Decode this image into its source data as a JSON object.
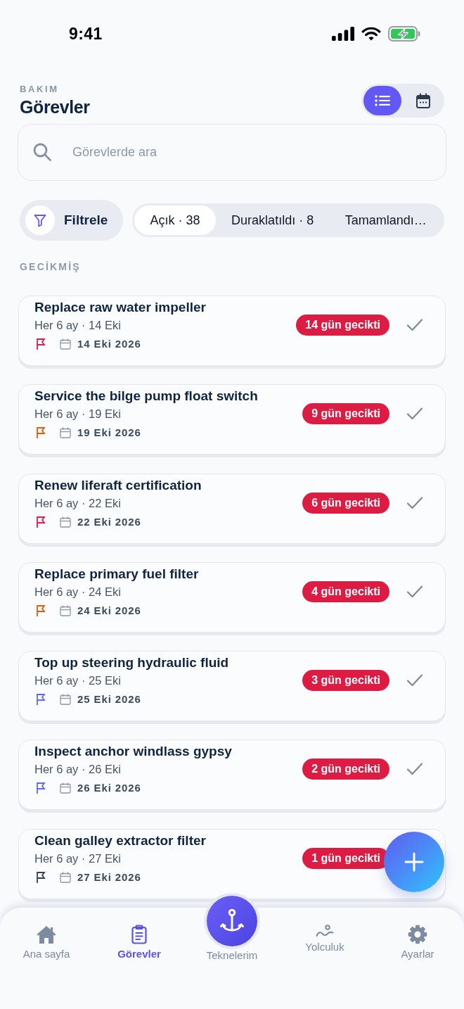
{
  "status_bar": {
    "time": "9:41"
  },
  "header": {
    "eyebrow": "BAKIM",
    "title": "Görevler",
    "views": [
      {
        "kind": "list",
        "selected": true
      },
      {
        "kind": "calendar",
        "selected": false
      }
    ]
  },
  "search": {
    "placeholder": "Görevlerde ara"
  },
  "filter_button": {
    "label": "Filtrele"
  },
  "status_tabs": [
    {
      "label": "Açık · 38",
      "selected": true
    },
    {
      "label": "Duraklatıldı · 8",
      "selected": false
    },
    {
      "label": "Tamamlandı…",
      "selected": false
    }
  ],
  "sections": [
    {
      "title": "GECİKMİŞ",
      "tasks": [
        {
          "title": "Replace raw water impeller",
          "recurrence": "Her 6 ay · 14 Eki",
          "due_date": "14 Eki 2026",
          "color": "#e11d48",
          "badge": "14 gün gecikti"
        },
        {
          "title": "Service the bilge pump float switch",
          "recurrence": "Her 6 ay · 19 Eki",
          "due_date": "19 Eki 2026",
          "color": "#ea580c",
          "badge": "9 gün gecikti"
        },
        {
          "title": "Renew liferaft certification",
          "recurrence": "Her 6 ay · 22 Eki",
          "due_date": "22 Eki 2026",
          "color": "#e11d48",
          "badge": "6 gün gecikti"
        },
        {
          "title": "Replace primary fuel filter",
          "recurrence": "Her 6 ay · 24 Eki",
          "due_date": "24 Eki 2026",
          "color": "#ea580c",
          "badge": "4 gün gecikti"
        },
        {
          "title": "Top up steering hydraulic fluid",
          "recurrence": "Her 6 ay · 25 Eki",
          "due_date": "25 Eki 2026",
          "color": "#6366f1",
          "badge": "3 gün gecikti"
        },
        {
          "title": "Inspect anchor windlass gypsy",
          "recurrence": "Her 6 ay · 26 Eki",
          "due_date": "26 Eki 2026",
          "color": "#6366f1",
          "badge": "2 gün gecikti"
        },
        {
          "title": "Clean galley extractor filter",
          "recurrence": "Her 6 ay · 27 Eki",
          "due_date": "27 Eki 2026",
          "color": "#334155",
          "badge": "1 gün gecikti"
        }
      ]
    }
  ],
  "tab_bar": {
    "items": [
      {
        "label": "Ana sayfa",
        "kind": "home",
        "selected": false
      },
      {
        "label": "Görevler",
        "kind": "tasks",
        "selected": true
      },
      {
        "label": "Teknelerim",
        "kind": "boats",
        "selected": false
      },
      {
        "label": "Yolculuk",
        "kind": "trips",
        "selected": false
      },
      {
        "label": "Ayarlar",
        "kind": "settings",
        "selected": false
      }
    ]
  }
}
